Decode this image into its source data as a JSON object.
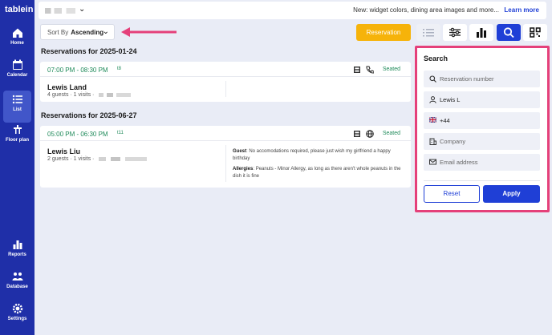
{
  "brand": {
    "logo": "tablein"
  },
  "sidebar": {
    "items": [
      {
        "label": "Home",
        "icon": "home-icon"
      },
      {
        "label": "Calendar",
        "icon": "calendar-icon"
      },
      {
        "label": "List",
        "icon": "list-icon",
        "active": true
      },
      {
        "label": "Floor plan",
        "icon": "floor-plan-icon"
      },
      {
        "label": "Reports",
        "icon": "reports-icon"
      },
      {
        "label": "Database",
        "icon": "database-icon"
      },
      {
        "label": "Settings",
        "icon": "settings-icon"
      }
    ]
  },
  "topbar": {
    "news": "New: widget colors, dining area images and more...",
    "learn_more": "Learn more"
  },
  "sort": {
    "label": "Sort By",
    "value": "Ascending"
  },
  "toolbar": {
    "reservation_label": "Reservation",
    "tools": [
      "list-view-icon",
      "filter-sliders-icon",
      "bar-chart-icon",
      "search-icon",
      "grid-icon"
    ]
  },
  "reservations": [
    {
      "heading": "Reservations for 2025-01-24",
      "time": "07:00 PM - 08:30 PM",
      "table": "t8",
      "status": "Seated",
      "name": "Lewis Land",
      "meta": "4 guests · 1 visits ·",
      "source_icon": "phone-icon"
    },
    {
      "heading": "Reservations for 2025-06-27",
      "time": "05:00 PM - 06:30 PM",
      "table": "t11",
      "status": "Seated",
      "name": "Lewis Liu",
      "meta": "2 guests · 1 visits ·",
      "source_icon": "globe-icon",
      "guest_note_label": "Guest",
      "guest_note": ": No accomodations required, please just wish my girlfriend a happy birthday",
      "allergies_label": "Allergies",
      "allergies_note": ": Peanuts - Minor Allergy, as long as there aren't whole peanuts in the dish it is fine"
    }
  ],
  "search": {
    "title": "Search",
    "reservation_number_placeholder": "Reservation number",
    "name_value": "Lewis L",
    "phone_value": "+44",
    "company_placeholder": "Company",
    "email_placeholder": "Email address",
    "reset_label": "Reset",
    "apply_label": "Apply"
  },
  "colors": {
    "sidebar": "#1f2fa8",
    "accent_blue": "#1f3fd6",
    "reservation_button": "#f6b30a",
    "seated_green": "#1f8a5a",
    "highlight_pink": "#e5407a"
  }
}
